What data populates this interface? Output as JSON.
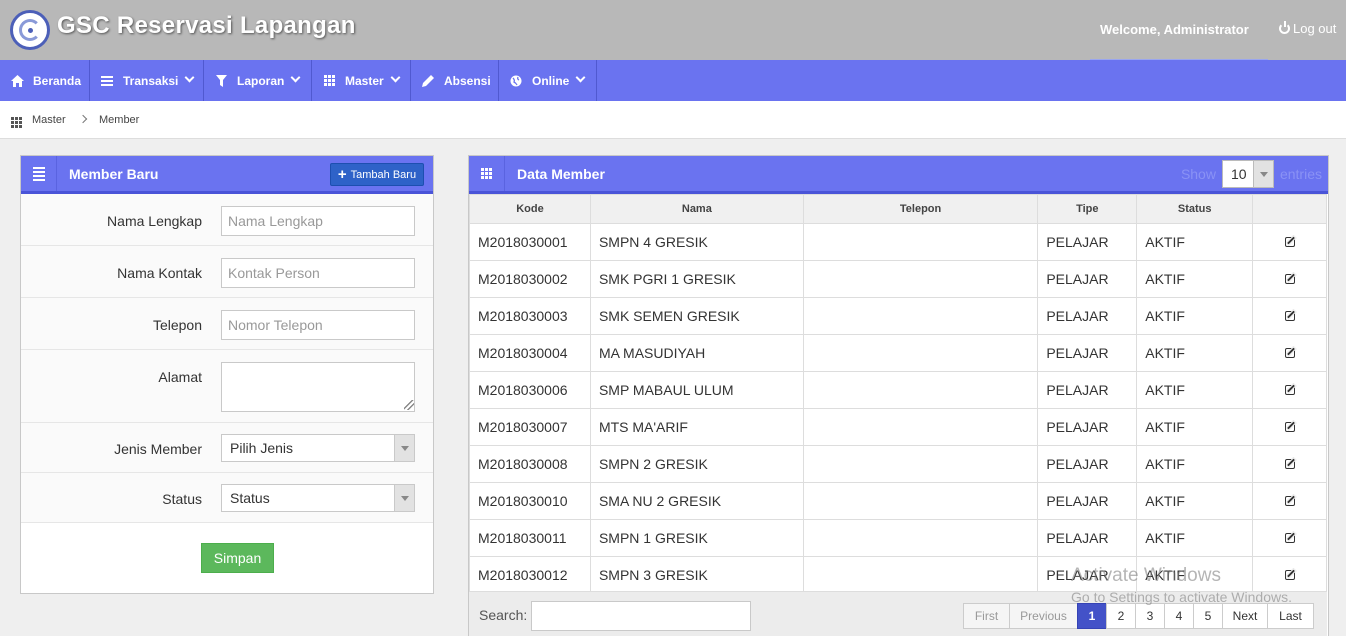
{
  "header": {
    "app_title": "GSC Reservasi Lapangan",
    "welcome": "Welcome, Administrator",
    "logout": "Log out"
  },
  "nav": {
    "items": [
      {
        "label": "Beranda",
        "icon": "home-icon"
      },
      {
        "label": "Transaksi",
        "icon": "list-icon"
      },
      {
        "label": "Laporan",
        "icon": "filter-icon"
      },
      {
        "label": "Master",
        "icon": "grid-icon"
      },
      {
        "label": "Absensi",
        "icon": "pencil-icon"
      },
      {
        "label": "Online",
        "icon": "globe-icon"
      }
    ]
  },
  "breadcrumb": {
    "level1": "Master",
    "level2": "Member"
  },
  "form_panel": {
    "title": "Member Baru",
    "add_button": "Tambah Baru",
    "fields": {
      "nama_lengkap": {
        "label": "Nama Lengkap",
        "placeholder": "Nama Lengkap",
        "value": ""
      },
      "nama_kontak": {
        "label": "Nama Kontak",
        "placeholder": "Kontak Person",
        "value": ""
      },
      "telepon": {
        "label": "Telepon",
        "placeholder": "Nomor Telepon",
        "value": ""
      },
      "alamat": {
        "label": "Alamat",
        "value": ""
      },
      "jenis_member": {
        "label": "Jenis Member",
        "selected": "Pilih Jenis"
      },
      "status": {
        "label": "Status",
        "selected": "Status"
      }
    },
    "submit": "Simpan"
  },
  "table_panel": {
    "title": "Data Member",
    "show_label": "Show",
    "entries_value": "10",
    "entries_label": "entries",
    "columns": [
      "Kode",
      "Nama",
      "Telepon",
      "Tipe",
      "Status"
    ],
    "rows": [
      {
        "kode": "M2018030001",
        "nama": "SMPN 4 GRESIK",
        "telepon": "",
        "tipe": "PELAJAR",
        "status": "AKTIF"
      },
      {
        "kode": "M2018030002",
        "nama": "SMK PGRI 1 GRESIK",
        "telepon": "",
        "tipe": "PELAJAR",
        "status": "AKTIF"
      },
      {
        "kode": "M2018030003",
        "nama": "SMK SEMEN GRESIK",
        "telepon": "",
        "tipe": "PELAJAR",
        "status": "AKTIF"
      },
      {
        "kode": "M2018030004",
        "nama": "MA MASUDIYAH",
        "telepon": "",
        "tipe": "PELAJAR",
        "status": "AKTIF"
      },
      {
        "kode": "M2018030006",
        "nama": "SMP MABAUL ULUM",
        "telepon": "",
        "tipe": "PELAJAR",
        "status": "AKTIF"
      },
      {
        "kode": "M2018030007",
        "nama": "MTS MA'ARIF",
        "telepon": "",
        "tipe": "PELAJAR",
        "status": "AKTIF"
      },
      {
        "kode": "M2018030008",
        "nama": "SMPN 2 GRESIK",
        "telepon": "",
        "tipe": "PELAJAR",
        "status": "AKTIF"
      },
      {
        "kode": "M2018030010",
        "nama": "SMA NU 2 GRESIK",
        "telepon": "",
        "tipe": "PELAJAR",
        "status": "AKTIF"
      },
      {
        "kode": "M2018030011",
        "nama": "SMPN 1 GRESIK",
        "telepon": "",
        "tipe": "PELAJAR",
        "status": "AKTIF"
      },
      {
        "kode": "M2018030012",
        "nama": "SMPN 3 GRESIK",
        "telepon": "",
        "tipe": "PELAJAR",
        "status": "AKTIF"
      }
    ],
    "search_label": "Search:",
    "search_value": "",
    "pagination": {
      "first": "First",
      "previous": "Previous",
      "pages": [
        "1",
        "2",
        "3",
        "4",
        "5"
      ],
      "current": "1",
      "next": "Next",
      "last": "Last"
    }
  },
  "watermark": {
    "line1": "Activate Windows",
    "line2": "Go to Settings to activate Windows."
  },
  "colors": {
    "nav": "#6a73f0",
    "topbar": "#b8b8b8",
    "primary_button": "#2e62c8",
    "success_button": "#5cb85c",
    "pager_active": "#4352c8"
  }
}
